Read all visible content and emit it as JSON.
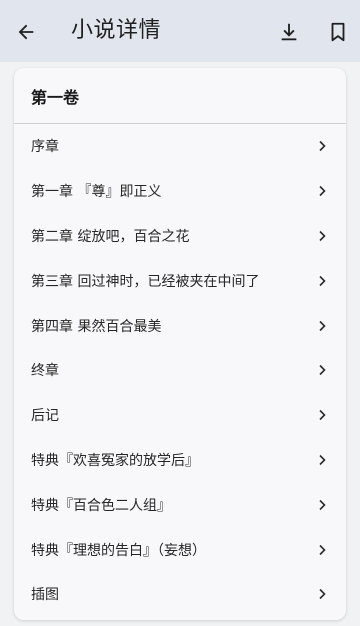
{
  "header": {
    "title": "小说详情",
    "back_icon": "arrow-back-icon",
    "download_icon": "download-icon",
    "bookmark_icon": "bookmark-icon"
  },
  "volume": {
    "title": "第一卷",
    "chapters": [
      {
        "label": "序章"
      },
      {
        "label": "第一章 『尊』即正义"
      },
      {
        "label": "第二章 绽放吧，百合之花"
      },
      {
        "label": "第三章 回过神时，已经被夹在中间了"
      },
      {
        "label": "第四章 果然百合最美"
      },
      {
        "label": "终章"
      },
      {
        "label": "后记"
      },
      {
        "label": "特典『欢喜冤家的放学后』"
      },
      {
        "label": "特典『百合色二人组』"
      },
      {
        "label": "特典『理想的告白』（妄想）"
      },
      {
        "label": "插图"
      }
    ]
  },
  "colors": {
    "topbar_bg": "#e1e5ee",
    "page_bg": "#f1f2f4",
    "card_bg": "#f8f8fa"
  }
}
